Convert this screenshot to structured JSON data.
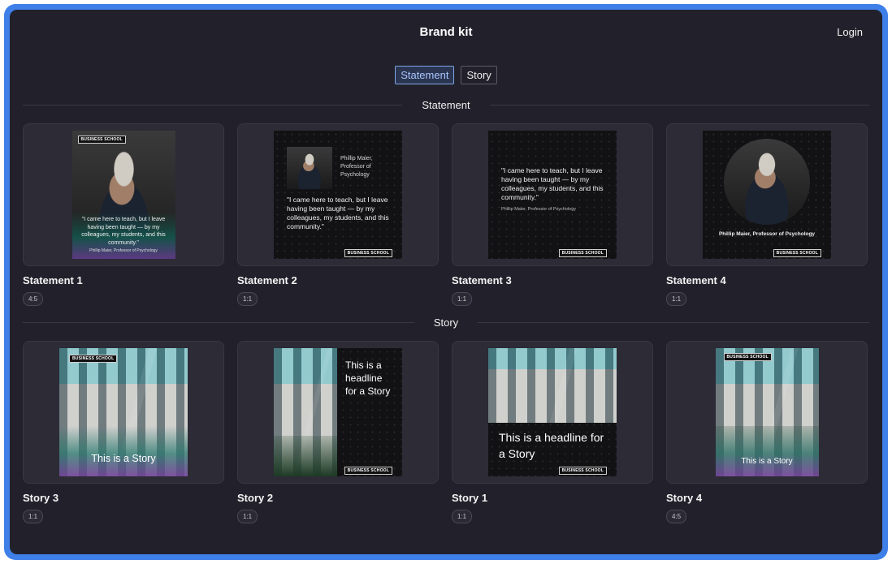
{
  "header": {
    "title": "Brand kit",
    "login_label": "Login"
  },
  "tabs": [
    {
      "label": "Statement",
      "active": true
    },
    {
      "label": "Story",
      "active": false
    }
  ],
  "sections": {
    "statement": {
      "label": "Statement",
      "cards": [
        {
          "title": "Statement 1",
          "ratio": "4:5"
        },
        {
          "title": "Statement 2",
          "ratio": "1:1"
        },
        {
          "title": "Statement 3",
          "ratio": "1:1"
        },
        {
          "title": "Statement 4",
          "ratio": "1:1"
        }
      ]
    },
    "story": {
      "label": "Story",
      "cards": [
        {
          "title": "Story 3",
          "ratio": "1:1"
        },
        {
          "title": "Story 2",
          "ratio": "1:1"
        },
        {
          "title": "Story 1",
          "ratio": "1:1"
        },
        {
          "title": "Story 4",
          "ratio": "4:5"
        }
      ]
    }
  },
  "artwork": {
    "logo": "BUSINESS SCHOOL",
    "quote": "\"I came here to teach, but I leave having been taught — by my colleagues, my students, and this community.\"",
    "attribution": "Phillip Maier, Professor of Psychology",
    "name_line": "Phillip Maier,",
    "title_line": "Professor of Psychology",
    "portrait_caption": "Phillip Maier, Professor of Psychology",
    "story_short": "This is a Story",
    "story_headline": "This is a headline for a Story"
  },
  "colors": {
    "accent": "#3f7fe8",
    "background": "#22212b",
    "card": "#2c2b36"
  }
}
